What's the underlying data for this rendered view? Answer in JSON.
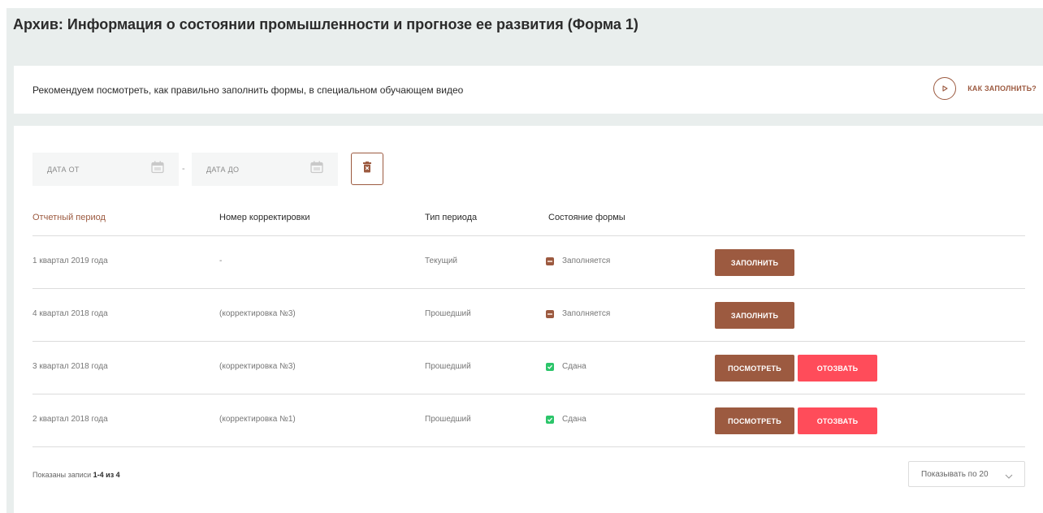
{
  "page": {
    "title": "Архив: Информация о состоянии промышленности и прогнозе ее развития (Форма 1)"
  },
  "info": {
    "text": "Рекомендуем посмотреть, как правильно заполнить формы, в специальном обучающем видео",
    "howto_label": "КАК ЗАПОЛНИТЬ?",
    "icon": "play-icon"
  },
  "filters": {
    "date_from_placeholder": "ДАТА ОТ",
    "date_to_placeholder": "ДАТА ДО",
    "separator": "-",
    "calendar_icon": "calendar-icon",
    "clear_icon": "trash-icon"
  },
  "table": {
    "columns": [
      "Отчетный период",
      "Номер корректировки",
      "Тип периода",
      "Состояние формы"
    ],
    "rows": [
      {
        "period": "1 квартал 2019 года",
        "correction": "-",
        "type": "Текущий",
        "status": "Заполняется",
        "status_kind": "filling",
        "actions": [
          "ЗАПОЛНИТЬ"
        ]
      },
      {
        "period": "4 квартал 2018 года",
        "correction": "(корректировка №3)",
        "type": "Прошедший",
        "status": "Заполняется",
        "status_kind": "filling",
        "actions": [
          "ЗАПОЛНИТЬ"
        ]
      },
      {
        "period": "3 квартал 2018 года",
        "correction": "(корректировка №3)",
        "type": "Прошедший",
        "status": "Сдана",
        "status_kind": "done",
        "actions": [
          "ПОСМОТРЕТЬ",
          "ОТОЗВАТЬ"
        ]
      },
      {
        "period": "2 квартал 2018 года",
        "correction": "(корректировка №1)",
        "type": "Прошедший",
        "status": "Сдана",
        "status_kind": "done",
        "actions": [
          "ПОСМОТРЕТЬ",
          "ОТОЗВАТЬ"
        ]
      }
    ]
  },
  "footer": {
    "shown_prefix": "Показаны записи",
    "shown_range": "1-4 из 4",
    "page_size_label": "Показывать по 20"
  },
  "colors": {
    "accent": "#9c5a40",
    "danger": "#ff4c5a",
    "success": "#2cc56a",
    "background": "#e9eeed"
  }
}
